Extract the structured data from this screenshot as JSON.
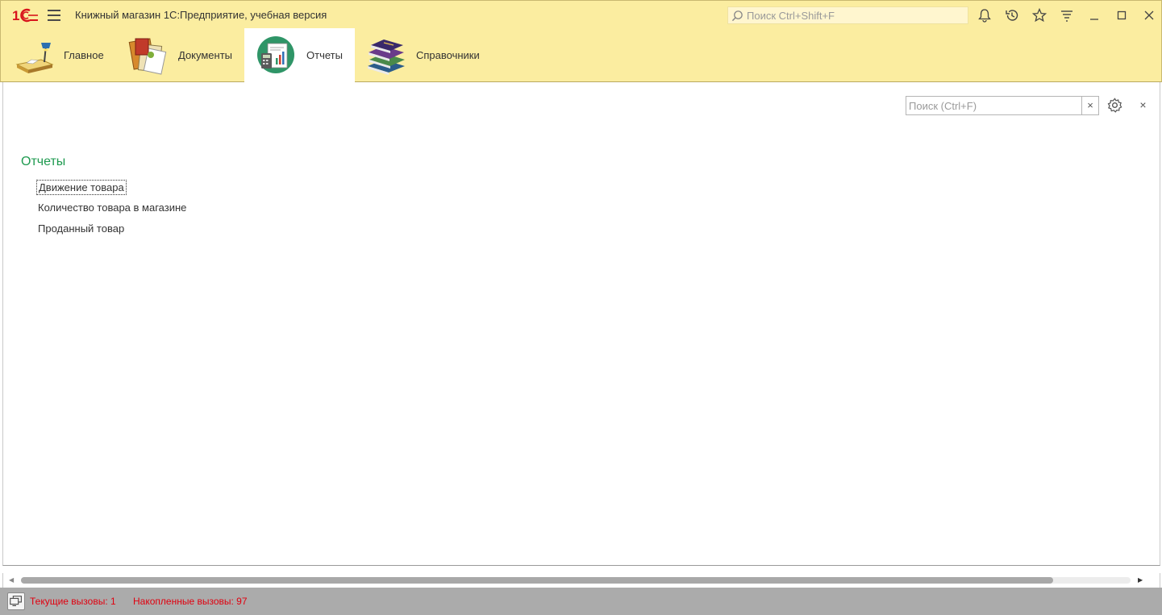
{
  "window": {
    "title": "Книжный магазин 1С:Предприятие, учебная версия",
    "search_placeholder": "Поиск Ctrl+Shift+F",
    "accent_color": "#fbeda0"
  },
  "sections": [
    {
      "label": "Главное",
      "icon": "desk-lamp-icon"
    },
    {
      "label": "Документы",
      "icon": "documents-icon"
    },
    {
      "label": "Отчеты",
      "icon": "reports-icon",
      "active": true
    },
    {
      "label": "Справочники",
      "icon": "books-stack-icon"
    }
  ],
  "content": {
    "search_placeholder": "Поиск (Ctrl+F)",
    "clear_label": "×",
    "close_label": "×",
    "group_title": "Отчеты",
    "reports": [
      {
        "label": "Движение товара"
      },
      {
        "label": "Количество товара в магазине"
      },
      {
        "label": "Проданный товар"
      }
    ]
  },
  "scroll": {
    "position_fraction": 0.0,
    "visible_fraction": 0.93
  },
  "status": {
    "current_calls": "Текущие вызовы: 1",
    "accumulated_calls": "Накопленные вызовы: 97"
  }
}
